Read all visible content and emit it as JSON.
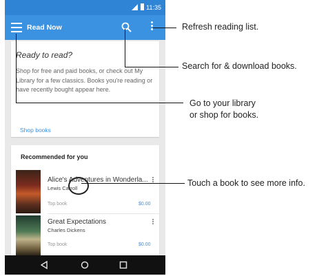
{
  "status": {
    "time": "11:35"
  },
  "appbar": {
    "title": "Read Now"
  },
  "card": {
    "heading": "Ready to read?",
    "body": "Shop for free and paid books, or check out My Library for a few classics. Books you're reading or have recently bought appear here.",
    "shop_link": "Shop books"
  },
  "recommended": {
    "title": "Recommended for you",
    "books": [
      {
        "title": "Alice's Adventures in Wonderla...",
        "author": "Lewis Carroll",
        "label": "Top book",
        "price": "$0.00"
      },
      {
        "title": "Great Expectations",
        "author": "Charles Dickens",
        "label": "Top book",
        "price": "$0.00"
      }
    ]
  },
  "annotations": {
    "refresh": "Refresh reading list.",
    "search": "Search for & download books.",
    "library": "Go to your library\nor shop for books.",
    "book": "Touch a book to see more info."
  },
  "icons": [
    "menu-icon",
    "search-icon",
    "more-vert-icon",
    "back-icon",
    "home-icon",
    "recents-icon"
  ],
  "colors": {
    "accent": "#3a92e0",
    "statusbar": "#2f84d6"
  }
}
